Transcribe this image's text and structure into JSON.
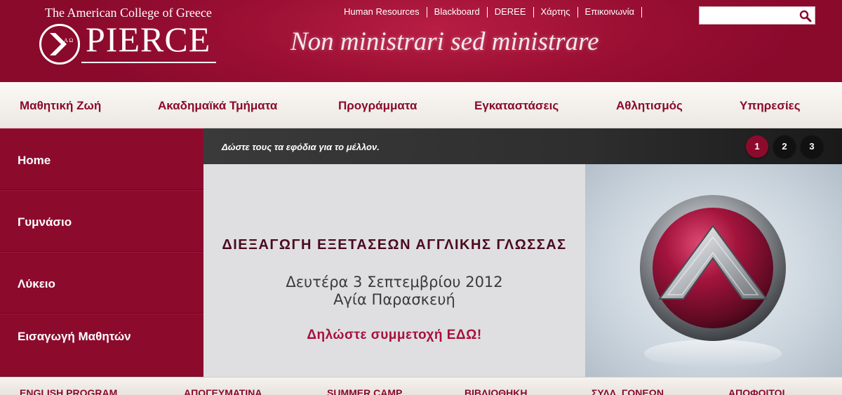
{
  "header": {
    "college_name": "The American College of Greece",
    "logo_name": "PIERCE",
    "emblem_letters": "Α Ω",
    "motto": "Non ministrari sed ministrare",
    "top_links": [
      {
        "label": "Human Resources"
      },
      {
        "label": "Blackboard"
      },
      {
        "label": "DEREE"
      },
      {
        "label": "Χάρτης"
      },
      {
        "label": "Επικοινωνία"
      }
    ],
    "search": {
      "value": "",
      "placeholder": ""
    }
  },
  "main_nav": [
    {
      "label": "Μαθητική Ζωή"
    },
    {
      "label": "Ακαδημαϊκά Τμήματα"
    },
    {
      "label": "Προγράμματα"
    },
    {
      "label": "Εγκαταστάσεις"
    },
    {
      "label": "Αθλητισμός"
    },
    {
      "label": "Υπηρεσίες"
    }
  ],
  "sidebar": [
    {
      "label": "Home"
    },
    {
      "label": "Γυμνάσιο"
    },
    {
      "label": "Λύκειο"
    },
    {
      "label": "Εισαγωγή Μαθητών"
    }
  ],
  "slider": {
    "caption": "Δώστε τους τα εφόδια για το μέλλον.",
    "pages": [
      "1",
      "2",
      "3"
    ],
    "active_page": "1",
    "title": "ΔΙΕΞΑΓΩΓΗ ΕΞΕΤΑΣΕΩΝ ΑΓΓΛΙΚΗΣ ΓΛΩΣΣΑΣ",
    "date": "Δευτέρα 3 Σεπτεμβρίου 2012",
    "location": "Αγία Παρασκευή",
    "cta": "Δηλώστε συμμετοχή ΕΔΩ!"
  },
  "bottom_nav": [
    {
      "label": "ENGLISH PROGRAM"
    },
    {
      "label": "ΑΠΟΓΕΥΜΑΤΙΝΑ"
    },
    {
      "label": "SUMMER CAMP"
    },
    {
      "label": "ΒΙΒΛΙΟΘΗΚΗ"
    },
    {
      "label": "ΣΥΛΛ. ΓΟΝΕΩΝ"
    },
    {
      "label": "ΑΠΟΦΟΙΤΟΙ"
    }
  ],
  "colors": {
    "brand_crimson": "#8c0b2d",
    "nav_text": "#8a0a2c",
    "cta_text": "#a8103a"
  }
}
